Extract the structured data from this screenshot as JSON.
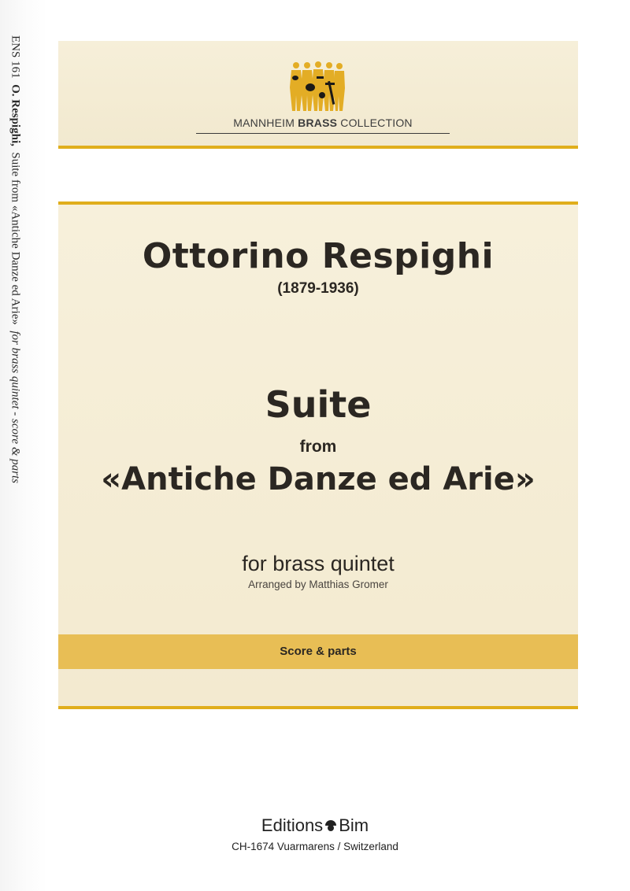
{
  "spine": {
    "catalog": "ENS 161",
    "composer": "O. Respighi,",
    "title": "Suite from «Antiche Danze ed Arie»",
    "scoring": "for brass quintet - score & parts"
  },
  "series": {
    "prefix": "MANNHEIM ",
    "highlight": "BRASS",
    "suffix": " COLLECTION",
    "logo": "brass-quintet-logo",
    "accent_color": "#e0ae1c"
  },
  "composer": {
    "name": "Ottorino Respighi",
    "dates": "(1879-1936)"
  },
  "work": {
    "title": "Suite",
    "from": "from",
    "subtitle": "«Antiche Danze ed Arie»",
    "scoring": "for brass quintet",
    "arranger": "Arranged by Matthias Gromer"
  },
  "edition": {
    "type": "Score & parts",
    "band_color": "#e8be55"
  },
  "publisher": {
    "name_part1": "Editions",
    "name_part2": "Bim",
    "address": "CH-1674 Vuarmarens / Switzerland"
  }
}
